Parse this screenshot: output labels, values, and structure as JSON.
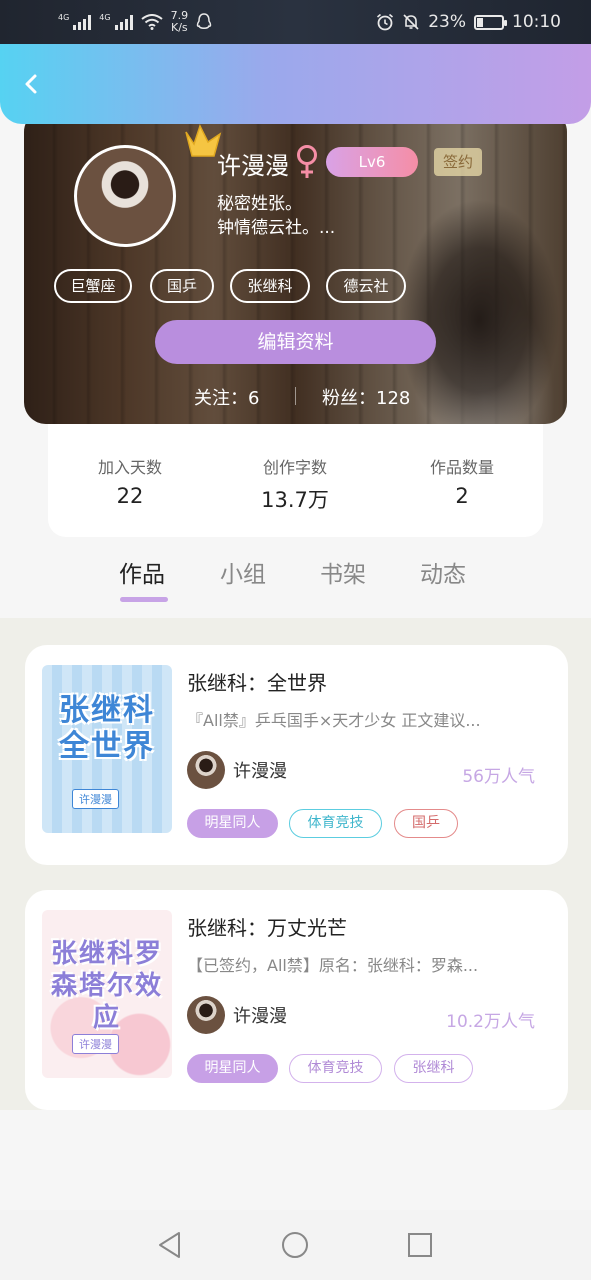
{
  "status_bar": {
    "network_1": "4G",
    "network_2": "4G",
    "speed_value": "7.9",
    "speed_unit": "K/s",
    "battery": "23%",
    "battery_level": 0.23,
    "time": "10:10"
  },
  "profile": {
    "name": "许漫漫",
    "level": "Lv6",
    "signed_badge": "签约",
    "bio_line1": "秘密姓张。",
    "bio_line2": "钟情德云社。...",
    "tags": [
      "巨蟹座",
      "国乒",
      "张继科",
      "德云社"
    ],
    "edit_button": "编辑资料",
    "following": "关注：6",
    "fans": "粉丝：128"
  },
  "stats": [
    {
      "label": "加入天数",
      "value": "22"
    },
    {
      "label": "创作字数",
      "value": "13.7万"
    },
    {
      "label": "作品数量",
      "value": "2"
    }
  ],
  "tabs": [
    "作品",
    "小组",
    "书架",
    "动态"
  ],
  "active_tab": "作品",
  "books": [
    {
      "cover_title": "张继科全世界",
      "cover_author": "许漫漫",
      "title": "张继科：全世界",
      "description": "『All禁』乒乓国手×天才少女 正文建议...",
      "author": "许漫漫",
      "popularity": "56万人气",
      "chips": [
        "明星同人",
        "体育竞技",
        "国乒"
      ]
    },
    {
      "cover_title": "张继科罗森塔尔效应",
      "cover_author": "许漫漫",
      "title": "张继科：万丈光芒",
      "description": "【已签约，All禁】原名：张继科：罗森...",
      "author": "许漫漫",
      "popularity": "10.2万人气",
      "chips": [
        "明星同人",
        "体育竞技",
        "张继科"
      ]
    }
  ],
  "colors": {
    "accent": "#c7a0e6",
    "header_start": "#56d2f2",
    "header_end": "#c39ee7"
  }
}
